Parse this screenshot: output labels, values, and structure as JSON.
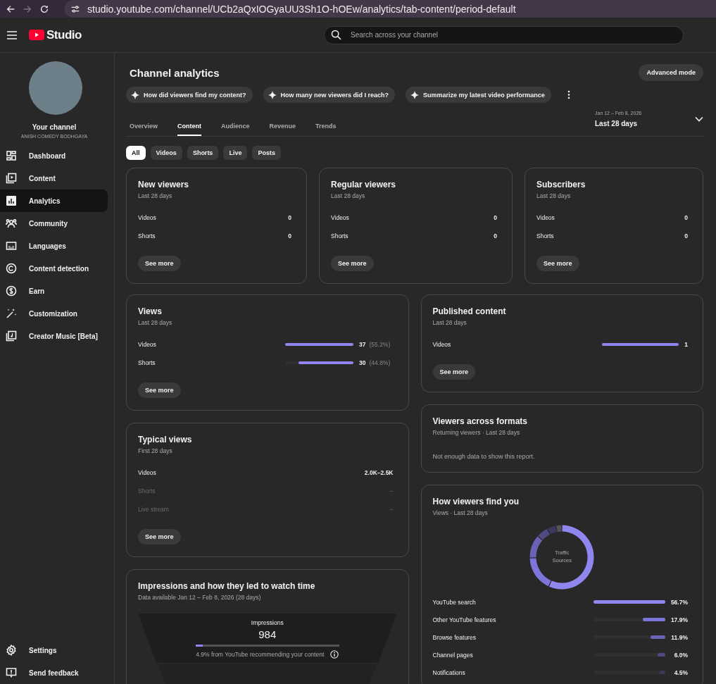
{
  "browser": {
    "url": "studio.youtube.com/channel/UCb2aQxIOGyaUU3Sh1O-hOEw/analytics/tab-content/period-default",
    "forward_disabled": true
  },
  "header": {
    "logo": "Studio",
    "search": {
      "placeholder": "Search across your channel"
    }
  },
  "sidebar": {
    "channel": {
      "label": "Your channel",
      "name": "ANISH COMEDY BODHGAYA"
    },
    "items": [
      {
        "label": "Dashboard",
        "selected": false
      },
      {
        "label": "Content",
        "selected": false
      },
      {
        "label": "Analytics",
        "selected": true
      },
      {
        "label": "Community",
        "selected": false
      },
      {
        "label": "Languages",
        "selected": false
      },
      {
        "label": "Content detection",
        "selected": false
      },
      {
        "label": "Earn",
        "selected": false
      },
      {
        "label": "Customization",
        "selected": false
      },
      {
        "label": "Creator Music [Beta]",
        "selected": false
      }
    ],
    "footer_items": [
      {
        "label": "Settings",
        "selected": false
      },
      {
        "label": "Send feedback",
        "selected": false
      }
    ]
  },
  "page": {
    "title": "Channel analytics",
    "advanced_button": "Advanced mode",
    "prompts": [
      "How did viewers find my content?",
      "How many new viewers did I reach?",
      "Summarize my latest video performance"
    ],
    "tabs": [
      {
        "label": "Overview",
        "selected": false
      },
      {
        "label": "Content",
        "selected": true
      },
      {
        "label": "Audience",
        "selected": false
      },
      {
        "label": "Revenue",
        "selected": false
      },
      {
        "label": "Trends",
        "selected": false
      }
    ],
    "date_range": {
      "range": "Jan 12 – Feb 8, 2026",
      "label": "Last 28 days"
    },
    "filters": [
      {
        "label": "All",
        "selected": true
      },
      {
        "label": "Videos",
        "selected": false
      },
      {
        "label": "Shorts",
        "selected": false
      },
      {
        "label": "Live",
        "selected": false
      },
      {
        "label": "Posts",
        "selected": false
      }
    ]
  },
  "top_cards": [
    {
      "kind": "values",
      "title": "New viewers",
      "subtitle": "Last 28 days",
      "rows": [
        {
          "label": "Videos",
          "value": "0",
          "disabled": false
        },
        {
          "label": "Shorts",
          "value": "0",
          "disabled": false
        }
      ],
      "button": "See more"
    },
    {
      "kind": "values",
      "title": "Regular viewers",
      "subtitle": "Last 28 days",
      "rows": [
        {
          "label": "Videos",
          "value": "0",
          "disabled": false
        },
        {
          "label": "Shorts",
          "value": "0",
          "disabled": false
        }
      ],
      "button": "See more"
    },
    {
      "kind": "values",
      "title": "Subscribers",
      "subtitle": "Last 28 days",
      "rows": [
        {
          "label": "Videos",
          "value": "0",
          "disabled": false
        },
        {
          "label": "Shorts",
          "value": "0",
          "disabled": false
        }
      ],
      "button": "See more"
    }
  ],
  "left_cards": [
    {
      "kind": "bars",
      "title": "Views",
      "subtitle": "Last 28 days",
      "rows": [
        {
          "label": "Videos",
          "value": "37",
          "percent": "(55.2%)",
          "level": 1
        },
        {
          "label": "Shorts",
          "value": "30",
          "percent": "(44.8%)",
          "level": 0.8
        }
      ],
      "button": "See more"
    },
    {
      "kind": "values",
      "title": "Typical views",
      "subtitle": "First 28 days",
      "rows": [
        {
          "label": "Videos",
          "value": "2.0K–2.5K",
          "disabled": false
        },
        {
          "label": "Shorts",
          "value": "–",
          "disabled": true
        },
        {
          "label": "Live stream",
          "value": "–",
          "disabled": true
        }
      ],
      "button": "See more"
    },
    {
      "kind": "funnel",
      "title": "Impressions and how they led to watch time",
      "subtitle": "Data available Jan 12 – Feb 8, 2026 (28 days)",
      "funnel": {
        "label": "Impressions",
        "value": "984",
        "level": 0.049,
        "note": "4.9% from YouTube recommending your content"
      }
    }
  ],
  "right_cards": [
    {
      "kind": "bars",
      "title": "Published content",
      "subtitle": "Last 28 days",
      "rows": [
        {
          "label": "Videos",
          "value": "1",
          "level": 1
        }
      ],
      "button": "See more"
    },
    {
      "kind": "message",
      "title": "Viewers across formats",
      "subtitle": "Returning viewers · Last 28 days",
      "message": "Not enough data to show this report."
    },
    {
      "kind": "traffic",
      "title": "How viewers find you",
      "subtitle": "Views · Last 28 days",
      "center_label": "Traffic Sources",
      "chart_data": {
        "type": "donut",
        "values": [
          56.7,
          17.9,
          11.9,
          6.0,
          4.5,
          3.0
        ]
      },
      "rows": [
        {
          "label": "YouTube search",
          "value": "56.7%",
          "level": 1,
          "color": "#8f86f0"
        },
        {
          "label": "Other YouTube features",
          "value": "17.9%",
          "level": 0.316,
          "color": "#7d75d9"
        },
        {
          "label": "Browse features",
          "value": "11.9%",
          "level": 0.21,
          "color": "#6a63b5"
        },
        {
          "label": "Channel pages",
          "value": "6.0%",
          "level": 0.106,
          "color": "#4e4a82"
        },
        {
          "label": "Notifications",
          "value": "4.5%",
          "level": 0.079,
          "color": "#3c3960"
        }
      ]
    }
  ]
}
